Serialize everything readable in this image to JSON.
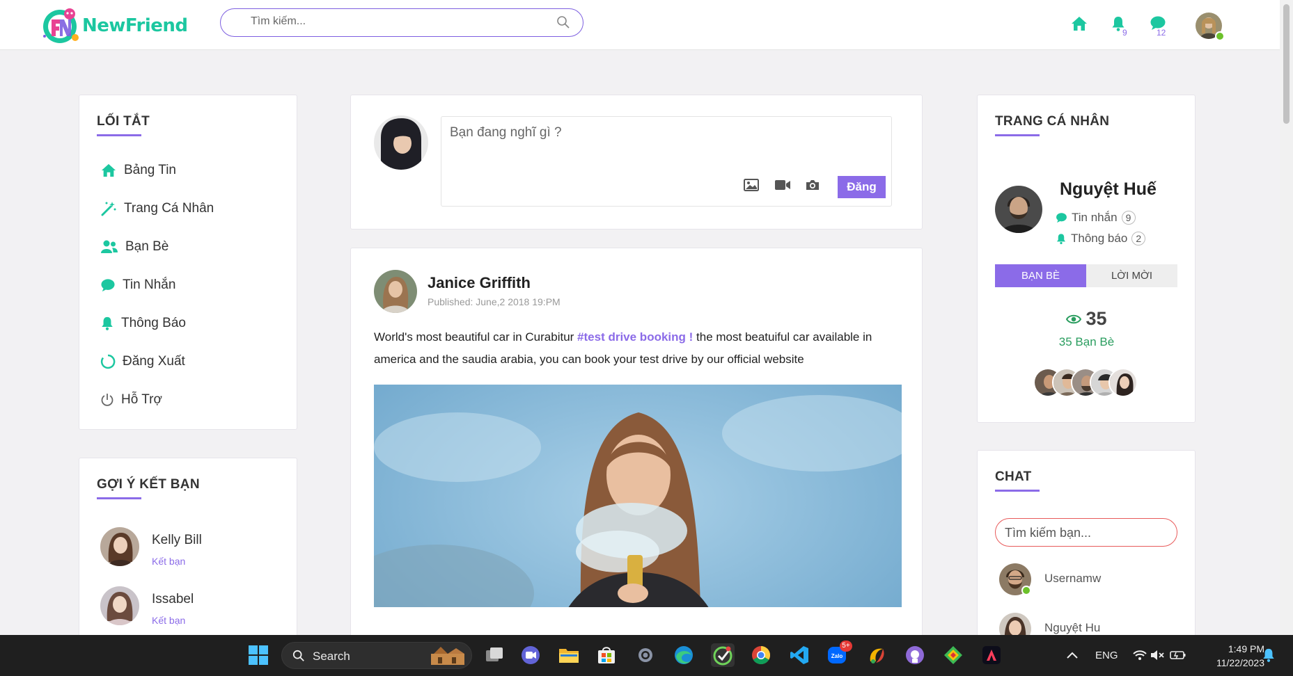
{
  "app": {
    "name": "NewFriend"
  },
  "colors": {
    "accent": "#8b6be8",
    "brand": "#1cc7a0",
    "online": "#6cc12a",
    "danger": "#e85a5a"
  },
  "header": {
    "search_placeholder": "Tìm kiếm...",
    "notif_count": "9",
    "message_count": "12"
  },
  "shortcuts": {
    "title": "LỐI TẮT",
    "items": [
      {
        "label": "Bảng Tin",
        "icon": "home-icon"
      },
      {
        "label": "Trang Cá Nhân",
        "icon": "magic-wand-icon"
      },
      {
        "label": "Bạn Bè",
        "icon": "users-icon"
      },
      {
        "label": "Tin Nhắn",
        "icon": "chat-icon"
      },
      {
        "label": "Thông Báo",
        "icon": "bell-icon"
      },
      {
        "label": "Đăng Xuất",
        "icon": "circle-icon"
      },
      {
        "label": "Hỗ Trợ",
        "icon": "power-icon"
      }
    ]
  },
  "suggestions": {
    "title": "GỢI Ý KẾT BẠN",
    "items": [
      {
        "name": "Kelly Bill",
        "action": "Kết bạn"
      },
      {
        "name": "Issabel",
        "action": "Kết bạn"
      }
    ]
  },
  "composer": {
    "placeholder": "Bạn đang nghĩ gì ?",
    "post_label": "Đăng"
  },
  "post": {
    "author": "Janice Griffith",
    "published": "Published: June,2 2018 19:PM",
    "text_before": "World's most beautiful car in Curabitur ",
    "tag": "#test drive booking !",
    "text_after": " the most beatuiful car available in america and the saudia arabia, you can book your test drive by our official website"
  },
  "profile": {
    "title": "TRANG CÁ NHÂN",
    "name": "Nguyệt Huế",
    "messages_label": "Tin nhắn",
    "messages_count": "9",
    "notifications_label": "Thông báo",
    "notifications_count": "2",
    "tab_friends": "BẠN BÈ",
    "tab_invites": "LỜI MỜI",
    "friend_count": "35",
    "friend_count_label": "35 Bạn Bè"
  },
  "chat": {
    "title": "CHAT",
    "search_placeholder": "Tìm kiếm bạn...",
    "contacts": [
      {
        "name": "Usernamw",
        "online": true
      },
      {
        "name": "Nguyệt Hu",
        "online": false
      }
    ]
  },
  "taskbar": {
    "search_label": "Search",
    "zalo_badge": "5+",
    "language": "ENG",
    "time": "1:49 PM",
    "date": "11/22/2023"
  }
}
